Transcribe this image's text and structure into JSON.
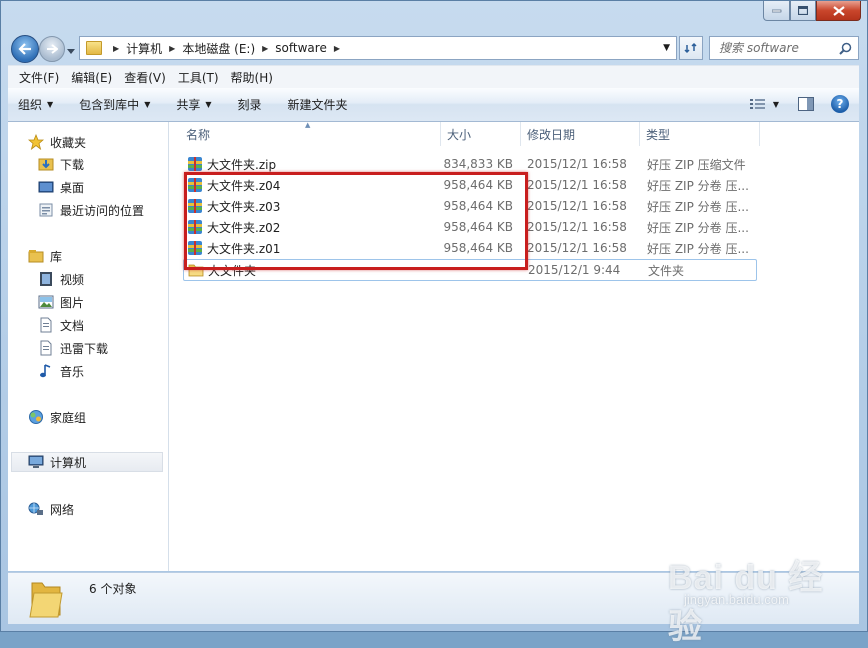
{
  "address": {
    "crumbs": [
      "计算机",
      "本地磁盘 (E:)",
      "software"
    ]
  },
  "search": {
    "placeholder": "搜索 software"
  },
  "menu": [
    "文件(F)",
    "编辑(E)",
    "查看(V)",
    "工具(T)",
    "帮助(H)"
  ],
  "commands": [
    {
      "label": "组织",
      "dropdown": true
    },
    {
      "label": "包含到库中",
      "dropdown": true
    },
    {
      "label": "共享",
      "dropdown": true
    },
    {
      "label": "刻录",
      "dropdown": false
    },
    {
      "label": "新建文件夹",
      "dropdown": false
    }
  ],
  "nav": {
    "favorites": "收藏夹",
    "favorites_items": [
      "下载",
      "桌面",
      "最近访问的位置"
    ],
    "libraries": "库",
    "libraries_items": [
      "视频",
      "图片",
      "文档",
      "迅雷下载",
      "音乐"
    ],
    "homegroup": "家庭组",
    "computer": "计算机",
    "network": "网络"
  },
  "columns": {
    "name": "名称",
    "size": "大小",
    "date": "修改日期",
    "type": "类型"
  },
  "files": [
    {
      "name": "大文件夹.zip",
      "size": "834,833 KB",
      "date": "2015/12/1 16:58",
      "type": "好压 ZIP 压缩文件",
      "kind": "archive"
    },
    {
      "name": "大文件夹.z04",
      "size": "958,464 KB",
      "date": "2015/12/1 16:58",
      "type": "好压 ZIP 分卷 压...",
      "kind": "archive"
    },
    {
      "name": "大文件夹.z03",
      "size": "958,464 KB",
      "date": "2015/12/1 16:58",
      "type": "好压 ZIP 分卷 压...",
      "kind": "archive"
    },
    {
      "name": "大文件夹.z02",
      "size": "958,464 KB",
      "date": "2015/12/1 16:58",
      "type": "好压 ZIP 分卷 压...",
      "kind": "archive"
    },
    {
      "name": "大文件夹.z01",
      "size": "958,464 KB",
      "date": "2015/12/1 16:58",
      "type": "好压 ZIP 分卷 压...",
      "kind": "archive"
    },
    {
      "name": "大文件夹",
      "size": "",
      "date": "2015/12/1 9:44",
      "type": "文件夹",
      "kind": "folder"
    }
  ],
  "details": {
    "count": "6 个对象"
  },
  "watermark": {
    "line1": "Bai du 经验",
    "line2": "jingyan.baidu.com"
  },
  "colors": {
    "highlight": "#c81e1e",
    "accent": "#2f6fb6"
  }
}
